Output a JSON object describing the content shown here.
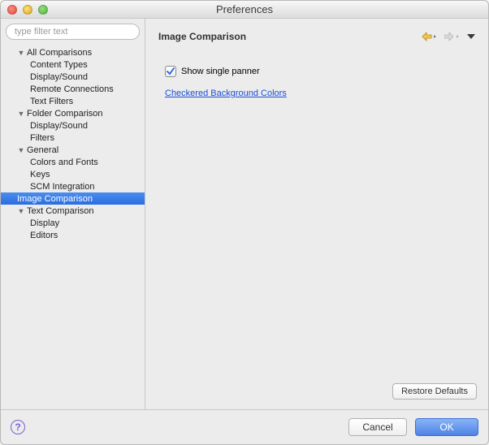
{
  "window": {
    "title": "Preferences"
  },
  "filter": {
    "placeholder": "type filter text"
  },
  "tree": {
    "all_comparisons": {
      "label": "All Comparisons"
    },
    "content_types": {
      "label": "Content Types"
    },
    "display_sound": {
      "label": "Display/Sound"
    },
    "remote_connections": {
      "label": "Remote Connections"
    },
    "text_filters": {
      "label": "Text Filters"
    },
    "folder_comparison": {
      "label": "Folder Comparison"
    },
    "fc_display_sound": {
      "label": "Display/Sound"
    },
    "fc_filters": {
      "label": "Filters"
    },
    "general": {
      "label": "General"
    },
    "colors_fonts": {
      "label": "Colors and Fonts"
    },
    "keys": {
      "label": "Keys"
    },
    "scm_integration": {
      "label": "SCM Integration"
    },
    "image_comparison": {
      "label": "Image Comparison"
    },
    "text_comparison": {
      "label": "Text Comparison"
    },
    "tc_display": {
      "label": "Display"
    },
    "tc_editors": {
      "label": "Editors"
    }
  },
  "pane": {
    "title": "Image Comparison",
    "show_single_panner": {
      "label": "Show single panner",
      "checked": true
    },
    "link_label": "Checkered Background Colors",
    "restore_defaults": "Restore Defaults"
  },
  "footer": {
    "help_glyph": "?",
    "cancel": "Cancel",
    "ok": "OK"
  }
}
